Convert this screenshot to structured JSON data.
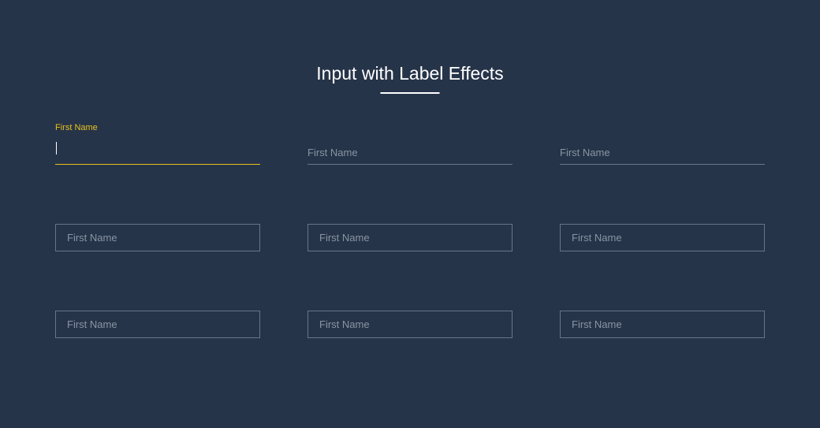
{
  "header": {
    "title": "Input with Label Effects"
  },
  "fields": {
    "row1": {
      "field1": {
        "label": "First Name",
        "placeholder": ""
      },
      "field2": {
        "placeholder": "First Name"
      },
      "field3": {
        "placeholder": "First Name"
      }
    },
    "row2": {
      "field1": {
        "placeholder": "First Name"
      },
      "field2": {
        "placeholder": "First Name"
      },
      "field3": {
        "placeholder": "First Name"
      }
    },
    "row3": {
      "field1": {
        "placeholder": "First Name"
      },
      "field2": {
        "placeholder": "First Name"
      },
      "field3": {
        "placeholder": "First Name"
      }
    }
  }
}
